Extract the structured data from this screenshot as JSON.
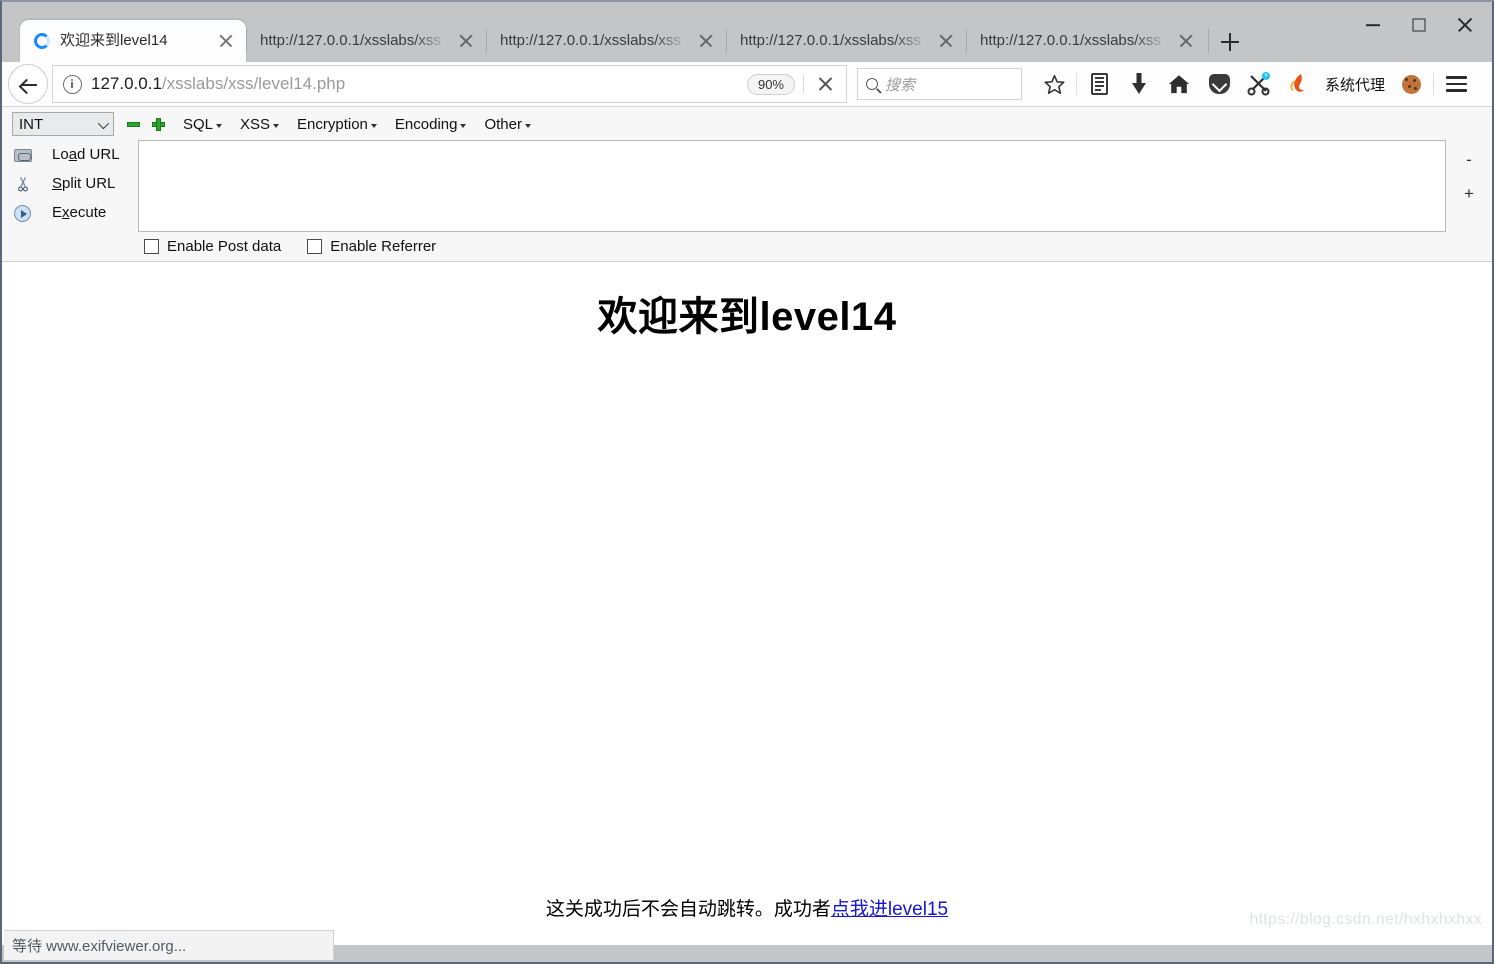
{
  "window": {
    "controls": {
      "minimize": "minimize-button",
      "maximize": "maximize-button",
      "close": "close-button"
    }
  },
  "tabs": [
    {
      "title": "欢迎来到level14",
      "active": true,
      "favicon": "loading-spinner-icon"
    },
    {
      "title": "http://127.0.0.1/xsslabs/xss",
      "active": false
    },
    {
      "title": "http://127.0.0.1/xsslabs/xss",
      "active": false
    },
    {
      "title": "http://127.0.0.1/xsslabs/xss",
      "active": false
    },
    {
      "title": "http://127.0.0.1/xsslabs/xss",
      "active": false
    }
  ],
  "newtab_label": "+",
  "navbar": {
    "back_icon": "back-arrow-icon",
    "site_info_icon": "info-icon",
    "url_host": "127.0.0.1",
    "url_path": "/xsslabs/xss/level14.php",
    "zoom_level": "90%",
    "stop_icon": "stop-icon",
    "search_placeholder": "搜索",
    "search_value": "",
    "icons": [
      "bookmark-star-icon",
      "reader-view-icon",
      "downloads-icon",
      "home-icon",
      "pocket-icon",
      "screenshot-tool-icon",
      "flame-icon"
    ],
    "proxy_label": "系统代理",
    "cookie_icon": "cookie-manager-icon",
    "menu_icon": "hamburger-menu-icon"
  },
  "hackbar": {
    "type_select": "INT",
    "select_options": [
      "INT"
    ],
    "minus_button": "remove-icon",
    "plus_button": "add-icon",
    "menus": [
      "SQL",
      "XSS",
      "Encryption",
      "Encoding",
      "Other"
    ],
    "actions": [
      {
        "label": "Load URL",
        "accel": "a",
        "icon": "load-url-icon"
      },
      {
        "label": "Split URL",
        "accel": "S",
        "icon": "split-url-icon"
      },
      {
        "label": "Execute",
        "accel": "x",
        "icon": "execute-icon"
      }
    ],
    "textarea_value": "",
    "checkboxes": [
      {
        "label": "Enable Post data",
        "checked": false
      },
      {
        "label": "Enable Referrer",
        "checked": false
      }
    ],
    "zoom_out": "-",
    "zoom_in": "+"
  },
  "page": {
    "title": "欢迎来到level14",
    "footer_text": "这关成功后不会自动跳转。成功者",
    "footer_link": "点我进level15"
  },
  "statusbar": {
    "text": "等待 www.exifviewer.org..."
  },
  "watermark": {
    "text": "https://blog.csdn.net/hxhxhxhxx"
  },
  "colors": {
    "chrome": "#c3c5c7",
    "toolbar": "#fdfdfd",
    "hackbar": "#f7f7f7",
    "link": "#1616cf",
    "accent_green": "#2fa32f",
    "window_border": "#5b6678"
  }
}
